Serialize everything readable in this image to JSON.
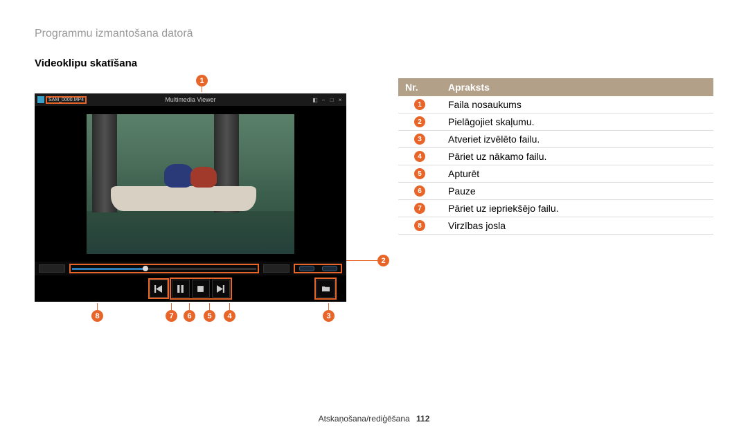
{
  "page": {
    "header": "Programmu izmantošana datorā",
    "subheader": "Videoklipu skatīšana"
  },
  "player": {
    "filename": "SAM_0000.MP4",
    "window_title": "Multimedia Viewer"
  },
  "callouts": {
    "top": "1",
    "right": "2",
    "bottom": {
      "c8": "8",
      "c7": "7",
      "c6": "6",
      "c5": "5",
      "c4": "4",
      "c3": "3"
    }
  },
  "table": {
    "header_nr": "Nr.",
    "header_desc": "Apraksts",
    "rows": [
      {
        "n": "1",
        "d": "Faila nosaukums"
      },
      {
        "n": "2",
        "d": "Pielāgojiet skaļumu."
      },
      {
        "n": "3",
        "d": "Atveriet izvēlēto failu."
      },
      {
        "n": "4",
        "d": "Pāriet uz nākamo failu."
      },
      {
        "n": "5",
        "d": "Apturēt"
      },
      {
        "n": "6",
        "d": "Pauze"
      },
      {
        "n": "7",
        "d": "Pāriet uz iepriekšējo failu."
      },
      {
        "n": "8",
        "d": "Virzības josla"
      }
    ]
  },
  "footer": {
    "section": "Atskaņošana/rediģēšana",
    "page": "112"
  }
}
